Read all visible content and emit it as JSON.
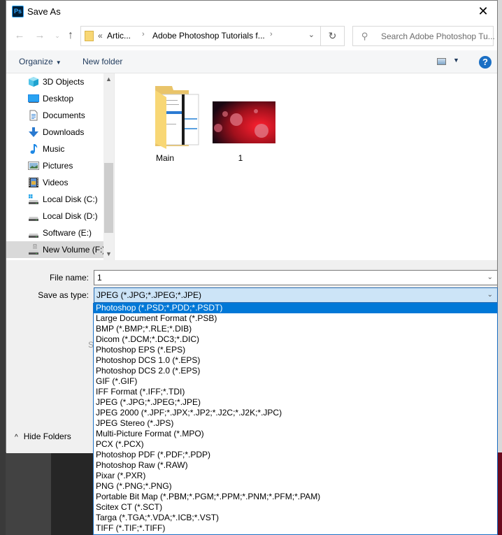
{
  "window": {
    "app_icon_text": "Ps",
    "title": "Save As",
    "close_glyph": "✕"
  },
  "navigation": {
    "back_glyph": "←",
    "forward_glyph": "→",
    "recent_glyph": "⌄",
    "up_glyph": "↑",
    "breadcrumb": [
      {
        "label": "«"
      },
      {
        "label": "Artic..."
      },
      {
        "label": "Adobe Photoshop Tutorials f..."
      }
    ],
    "breadcrumb_sep": "›",
    "dropdown_glyph": "⌄",
    "refresh_glyph": "↻",
    "search_placeholder": "Search Adobe Photoshop Tu...",
    "search_glyph": "⚲"
  },
  "toolbar": {
    "organize_label": "Organize",
    "organize_caret": "▼",
    "new_folder_label": "New folder",
    "view_caret": "▼",
    "help_glyph": "?"
  },
  "sidebar": {
    "items": [
      {
        "label": "3D Objects",
        "icon": "3d-objects-icon"
      },
      {
        "label": "Desktop",
        "icon": "desktop-icon"
      },
      {
        "label": "Documents",
        "icon": "documents-icon"
      },
      {
        "label": "Downloads",
        "icon": "downloads-icon"
      },
      {
        "label": "Music",
        "icon": "music-icon"
      },
      {
        "label": "Pictures",
        "icon": "pictures-icon"
      },
      {
        "label": "Videos",
        "icon": "videos-icon"
      },
      {
        "label": "Local Disk (C:)",
        "icon": "system-drive-icon"
      },
      {
        "label": "Local Disk (D:)",
        "icon": "drive-icon"
      },
      {
        "label": "Software (E:)",
        "icon": "drive-icon"
      },
      {
        "label": "New Volume (F:)",
        "icon": "locked-drive-icon",
        "selected": true
      }
    ],
    "scroll_up_glyph": "▲",
    "scroll_down_glyph": "▼"
  },
  "files": [
    {
      "name": "Main",
      "type": "folder"
    },
    {
      "name": "1",
      "type": "image"
    }
  ],
  "form": {
    "filename_label": "File name:",
    "filename_value": "1",
    "savetype_label": "Save as type:",
    "savetype_value": "JPEG (*.JPG;*.JPEG;*.JPE)",
    "chevron_glyph": "⌄",
    "hidden_partial_text": "S"
  },
  "hide_folders": {
    "caret": "^",
    "label": "Hide Folders"
  },
  "save_type_options": [
    {
      "label": "Photoshop (*.PSD;*.PDD;*.PSDT)",
      "highlighted": true
    },
    {
      "label": "Large Document Format (*.PSB)"
    },
    {
      "label": "BMP (*.BMP;*.RLE;*.DIB)"
    },
    {
      "label": "Dicom (*.DCM;*.DC3;*.DIC)"
    },
    {
      "label": "Photoshop EPS (*.EPS)"
    },
    {
      "label": "Photoshop DCS 1.0 (*.EPS)"
    },
    {
      "label": "Photoshop DCS 2.0 (*.EPS)"
    },
    {
      "label": "GIF (*.GIF)"
    },
    {
      "label": "IFF Format (*.IFF;*.TDI)"
    },
    {
      "label": "JPEG (*.JPG;*.JPEG;*.JPE)"
    },
    {
      "label": "JPEG 2000 (*.JPF;*.JPX;*.JP2;*.J2C;*.J2K;*.JPC)"
    },
    {
      "label": "JPEG Stereo (*.JPS)"
    },
    {
      "label": "Multi-Picture Format (*.MPO)"
    },
    {
      "label": "PCX (*.PCX)"
    },
    {
      "label": "Photoshop PDF (*.PDF;*.PDP)"
    },
    {
      "label": "Photoshop Raw (*.RAW)"
    },
    {
      "label": "Pixar (*.PXR)"
    },
    {
      "label": "PNG (*.PNG;*.PNG)"
    },
    {
      "label": "Portable Bit Map (*.PBM;*.PGM;*.PPM;*.PNM;*.PFM;*.PAM)"
    },
    {
      "label": "Scitex CT (*.SCT)"
    },
    {
      "label": "Targa (*.TGA;*.VDA;*.ICB;*.VST)"
    },
    {
      "label": "TIFF (*.TIF;*.TIFF)"
    }
  ],
  "colors": {
    "highlight": "#0078d7",
    "select_bg": "#cce4f7",
    "sidebar_selected": "#d9d9d9",
    "help_blue": "#1a6fc4"
  }
}
